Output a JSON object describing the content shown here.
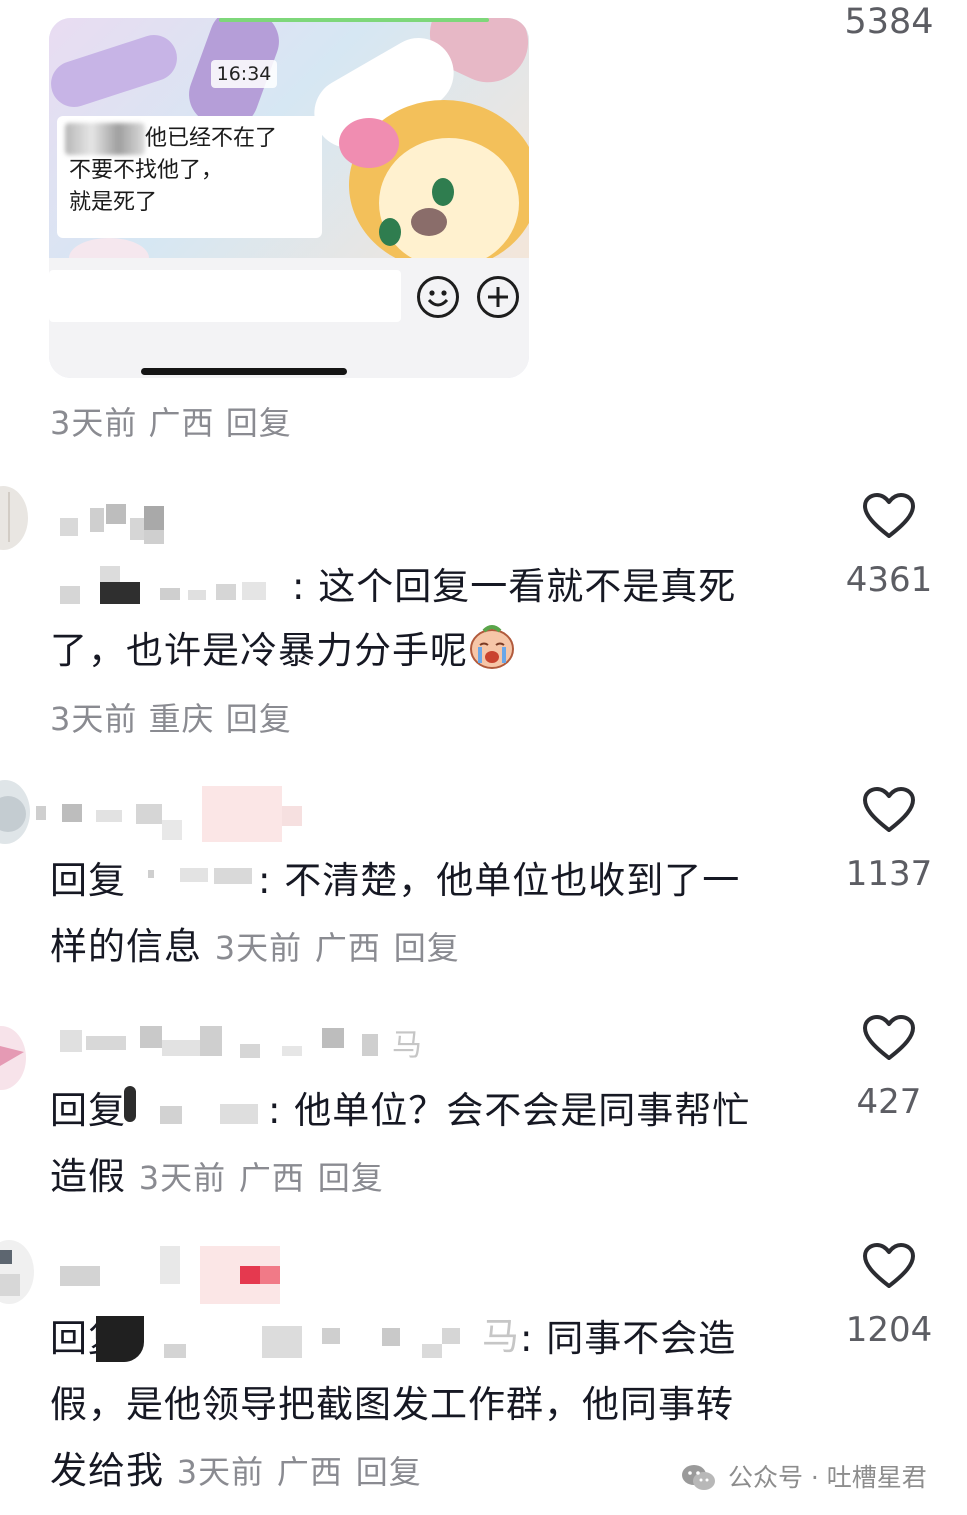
{
  "post": {
    "like_count": "5384",
    "chat_image": {
      "time": "16:34",
      "message_lines": [
        "他已经不在了",
        "不要不找他了，",
        "就是死了"
      ],
      "emoji_icon": "smile-icon",
      "plus_icon": "plus-circle-icon"
    },
    "meta": {
      "time": "3天前",
      "location": "广西",
      "reply": "回复"
    }
  },
  "comments": [
    {
      "username_fragment": "",
      "mention_suffix": "",
      "text_line1": ": 这个回复一看就不是真死",
      "text_line2": "了，也许是冷暴力分手呢",
      "emoji": "crying-face-sticker",
      "time": "3天前",
      "location": "重庆",
      "reply": "回复",
      "like_count": "4361"
    },
    {
      "reply_prefix": "回复",
      "text_line1": ": 不清楚，他单位也收到了一",
      "text_line2": "样的信息",
      "time": "3天前",
      "location": "广西",
      "reply": "回复",
      "like_count": "1137"
    },
    {
      "username_fragment": "马",
      "reply_prefix": "回复",
      "text_line1": ": 他单位？会不会是同事帮忙",
      "text_line2": "造假",
      "time": "3天前",
      "location": "广西",
      "reply": "回复",
      "like_count": "427"
    },
    {
      "reply_prefix": "回复",
      "mention_suffix": "马",
      "text_line1": ": 同事不会造",
      "text_line2": "假，是他领导把截图发工作群，他同事转",
      "text_line3": "发给我",
      "time": "3天前",
      "location": "广西",
      "reply": "回复",
      "like_count": "1204"
    }
  ],
  "watermark": {
    "icon": "wechat-icon",
    "text": "公众号 · 吐槽星君"
  },
  "colors": {
    "text_primary": "#161823",
    "text_meta": "#8a8b91",
    "like_count": "#5c5d63",
    "heart_stroke": "#2b2c31"
  }
}
